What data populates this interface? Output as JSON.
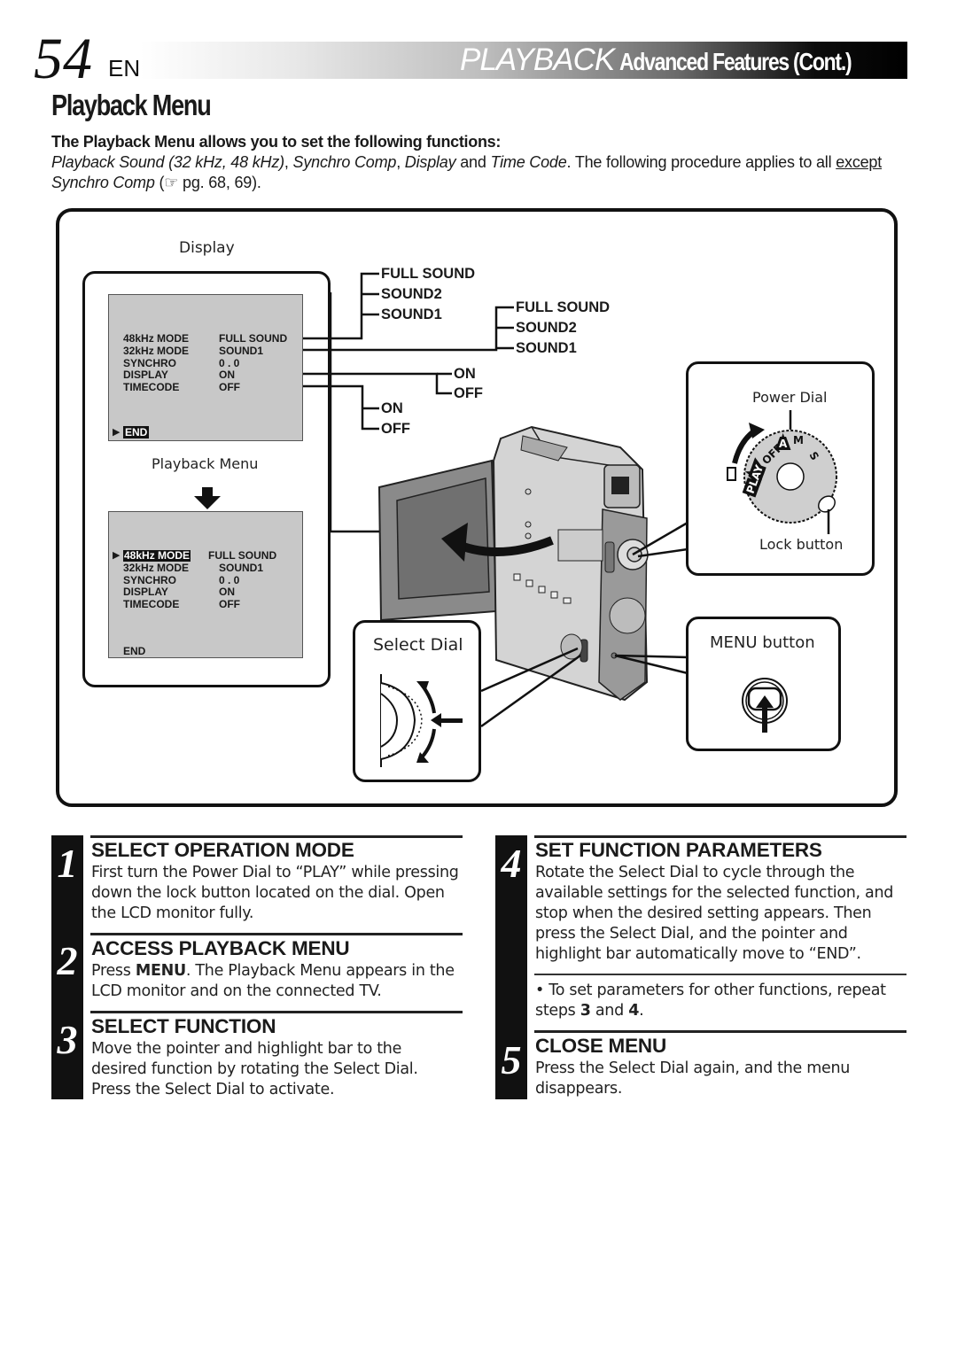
{
  "header": {
    "page_number": "54",
    "language": "EN",
    "title_main": "PLAYBACK",
    "title_sub": "Advanced Features (Cont.)"
  },
  "section": {
    "title": "Playback Menu",
    "intro_bold": "The Playback Menu allows you to set the following functions:",
    "intro_parts": {
      "p1": "Playback Sound (32 kHz, 48 kHz)",
      "p2": ", ",
      "p3": "Synchro Comp",
      "p4": ", ",
      "p5": "Display",
      "p6": " and ",
      "p7": "Time Code",
      "p8": ". The following procedure applies to all ",
      "p9": "except",
      "p10": " ",
      "p11": "Synchro Comp",
      "p12": " (",
      "p13": "☞",
      "p14": " pg. 68, 69)."
    }
  },
  "diagram": {
    "display_label": "Display",
    "playback_menu_label": "Playback Menu",
    "menu_items": [
      {
        "key": "48kHz  MODE",
        "value": "FULL SOUND"
      },
      {
        "key": "32kHz  MODE",
        "value": "SOUND1"
      },
      {
        "key": "SYNCHRO",
        "value": "0 . 0"
      },
      {
        "key": "DISPLAY",
        "value": "ON"
      },
      {
        "key": "TIMECODE",
        "value": "OFF"
      }
    ],
    "end_label": "END",
    "options_48k": [
      "FULL SOUND",
      "SOUND2",
      "SOUND1"
    ],
    "options_32k": [
      "FULL SOUND",
      "SOUND2",
      "SOUND1"
    ],
    "options_display": [
      "ON",
      "OFF"
    ],
    "options_timecode": [
      "ON",
      "OFF"
    ],
    "power_dial_label": "Power Dial",
    "power_dial_marks": {
      "play": "PLAY",
      "off": "OFF",
      "auto": "A",
      "manual": "M",
      "sq": "S"
    },
    "lock_button_label": "Lock button",
    "select_dial_label": "Select Dial",
    "menu_button_label": "MENU button"
  },
  "steps": [
    {
      "num": "1",
      "title": "SELECT OPERATION MODE",
      "body": "First turn the Power Dial to “PLAY” while pressing down the lock button located on the dial. Open the LCD monitor fully."
    },
    {
      "num": "2",
      "title": "ACCESS PLAYBACK MENU",
      "body_pre": "Press ",
      "body_bold": "MENU",
      "body_post": ". The Playback Menu appears in the LCD monitor and on the connected TV."
    },
    {
      "num": "3",
      "title": "SELECT FUNCTION",
      "body": "Move the pointer and highlight bar to the desired function by rotating the Select Dial. Press the Select Dial to activate."
    },
    {
      "num": "4",
      "title": "SET FUNCTION PARAMETERS",
      "body": "Rotate the Select Dial to cycle through the available settings for the selected function, and stop when the desired setting appears. Then press the Select Dial, and the pointer and highlight bar automatically move to “END”."
    },
    {
      "num": "5",
      "title": "CLOSE MENU",
      "body": "Press the Select Dial again, and the menu disappears."
    }
  ],
  "note": {
    "bullet": "•",
    "pre": "To set parameters for other functions, repeat steps ",
    "b1": "3",
    "mid": " and ",
    "b2": "4",
    "post": "."
  }
}
